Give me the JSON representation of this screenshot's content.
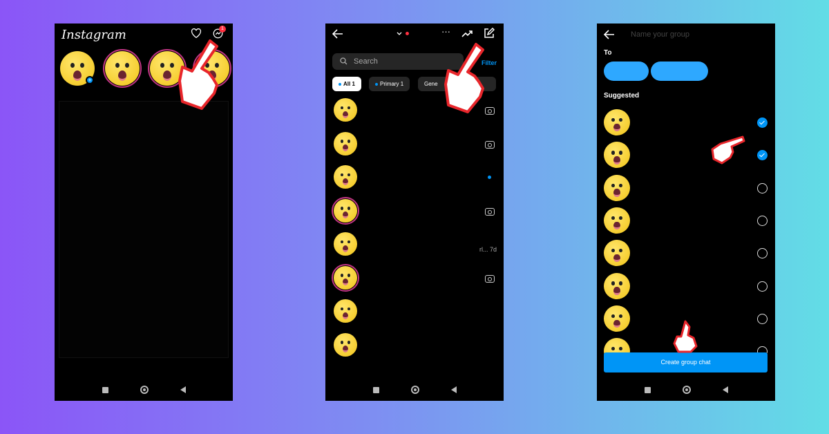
{
  "screen1": {
    "logo": "Instagram",
    "notification_count": "1"
  },
  "screen2": {
    "search_placeholder": "Search",
    "filter_label": "Filter",
    "chips": [
      {
        "label": "All 1",
        "active": true
      },
      {
        "label": "Primary 1",
        "active": false
      },
      {
        "label": "Gene",
        "active": false
      }
    ],
    "row_meta": "rl... 7d"
  },
  "screen3": {
    "group_name_placeholder": "Name your group",
    "to_label": "To",
    "suggested_label": "Suggested",
    "selected": [
      true,
      true,
      false,
      false,
      false,
      false,
      false,
      false
    ],
    "create_button": "Create group chat"
  },
  "colors": {
    "accent": "#0095f6",
    "pointer": "#e8262b"
  }
}
